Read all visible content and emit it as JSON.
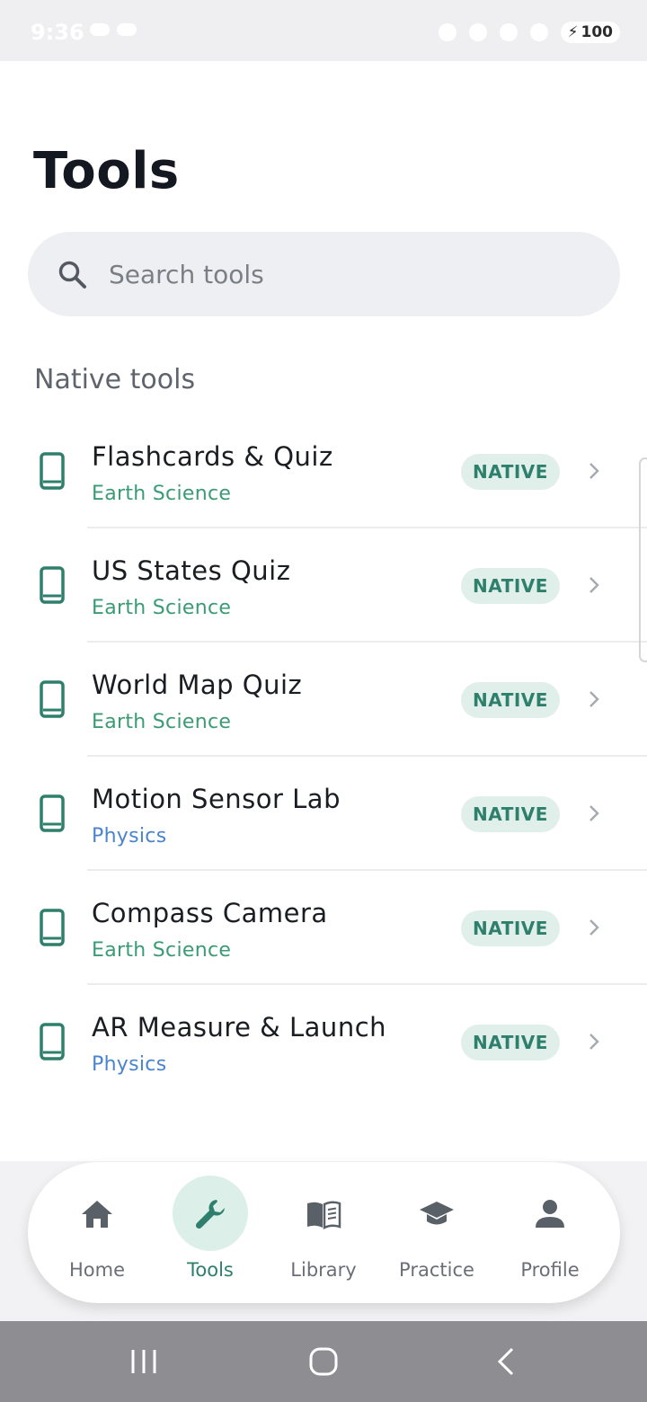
{
  "status_bar": {
    "time": "9:36",
    "battery": "100"
  },
  "page": {
    "title": "Tools"
  },
  "search": {
    "placeholder": "Search tools"
  },
  "section": {
    "label": "Native tools"
  },
  "tools": [
    {
      "name": "Flashcards & Quiz",
      "subject": "Earth Science",
      "badge": "NATIVE",
      "subject_color": "#3a9b75"
    },
    {
      "name": "US States Quiz",
      "subject": "Earth Science",
      "badge": "NATIVE",
      "subject_color": "#3a9b75"
    },
    {
      "name": "World Map Quiz",
      "subject": "Earth Science",
      "badge": "NATIVE",
      "subject_color": "#3a9b75"
    },
    {
      "name": "Motion Sensor Lab",
      "subject": "Physics",
      "badge": "NATIVE",
      "subject_color": "#4a84cf"
    },
    {
      "name": "Compass Camera",
      "subject": "Earth Science",
      "badge": "NATIVE",
      "subject_color": "#3a9b75"
    },
    {
      "name": "AR Measure & Launch",
      "subject": "Physics",
      "badge": "NATIVE",
      "subject_color": "#4a84cf"
    }
  ],
  "nav": {
    "items": [
      {
        "label": "Home",
        "icon": "home-icon"
      },
      {
        "label": "Tools",
        "icon": "wrench-icon",
        "active": true
      },
      {
        "label": "Library",
        "icon": "book-icon"
      },
      {
        "label": "Practice",
        "icon": "graduation-cap-icon"
      },
      {
        "label": "Profile",
        "icon": "person-icon"
      }
    ]
  },
  "colors": {
    "accent": "#2e7f6c",
    "accent_light": "#dcefe9",
    "earth": "#3a9b75",
    "physics": "#4a84cf"
  }
}
